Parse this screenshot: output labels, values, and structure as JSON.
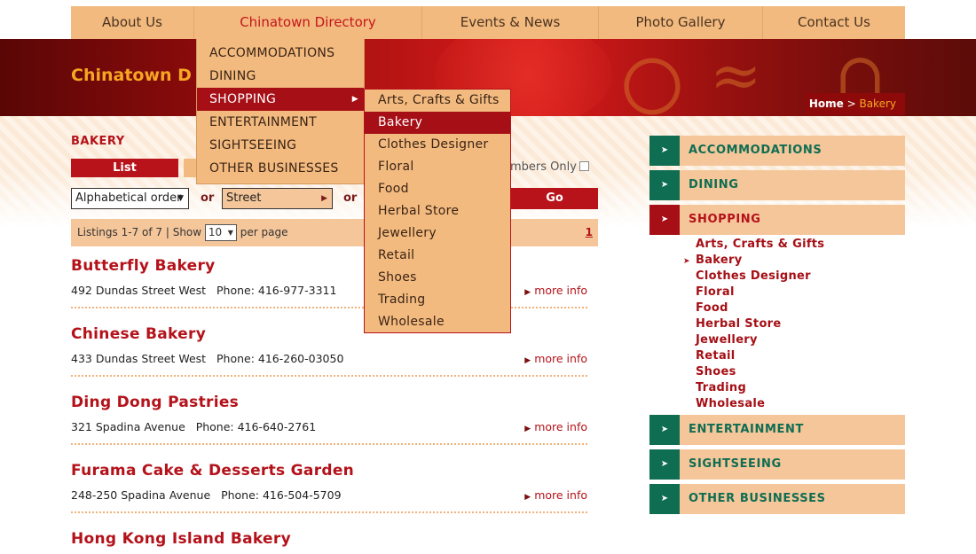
{
  "nav": {
    "items": [
      "About Us",
      "Chinatown Directory",
      "Events & News",
      "Photo Gallery",
      "Contact Us"
    ]
  },
  "site": {
    "title": "Chinatown D"
  },
  "breadcrumb": {
    "home": "Home",
    "separator": ">",
    "current": "Bakery"
  },
  "directory_menu": {
    "items": [
      "ACCOMMODATIONS",
      "DINING",
      "SHOPPING",
      "ENTERTAINMENT",
      "SIGHTSEEING",
      "OTHER BUSINESSES"
    ],
    "active": "SHOPPING"
  },
  "shopping_menu": {
    "items": [
      "Arts, Crafts & Gifts",
      "Bakery",
      "Clothes Designer",
      "Floral",
      "Food",
      "Herbal Store",
      "Jewellery",
      "Retail",
      "Shoes",
      "Trading",
      "Wholesale"
    ],
    "active": "Bakery"
  },
  "main": {
    "category_title": "BAKERY",
    "list_label": "List",
    "members_only_label": "embers Only",
    "sort_select": "Alphabetical order",
    "or_label": "or",
    "street_select": "Street",
    "go_label": "Go",
    "pager": {
      "listings_text": "Listings 1-7 of 7 | Show",
      "per_page_value": "10",
      "per_page_label": "per page",
      "page_link": "1"
    },
    "more_info_label": "more info",
    "listings": [
      {
        "name": "Butterfly Bakery",
        "address": "492 Dundas Street West",
        "phone": "Phone: 416-977-3311"
      },
      {
        "name": "Chinese Bakery",
        "address": "433 Dundas Street West",
        "phone": "Phone: 416-260-03050"
      },
      {
        "name": "Ding Dong Pastries",
        "address": "321 Spadina Avenue",
        "phone": "Phone: 416-640-2761"
      },
      {
        "name": "Furama Cake & Desserts Garden",
        "address": "248-250 Spadina Avenue",
        "phone": "Phone: 416-504-5709"
      },
      {
        "name": "Hong Kong Island Bakery",
        "address": "",
        "phone": ""
      }
    ]
  },
  "sidebar": {
    "categories": [
      "ACCOMMODATIONS",
      "DINING",
      "SHOPPING",
      "ENTERTAINMENT",
      "SIGHTSEEING",
      "OTHER BUSINESSES"
    ],
    "active": "SHOPPING",
    "shopping_sub": [
      "Arts, Crafts & Gifts",
      "Bakery",
      "Clothes Designer",
      "Floral",
      "Food",
      "Herbal Store",
      "Jewellery",
      "Retail",
      "Shoes",
      "Trading",
      "Wholesale"
    ],
    "current_sub": "Bakery"
  },
  "colors": {
    "accent_red": "#b4121a",
    "nav_orange": "#f3ba7f",
    "sidebar_green": "#0f6d52",
    "title_gold": "#f5a623"
  }
}
